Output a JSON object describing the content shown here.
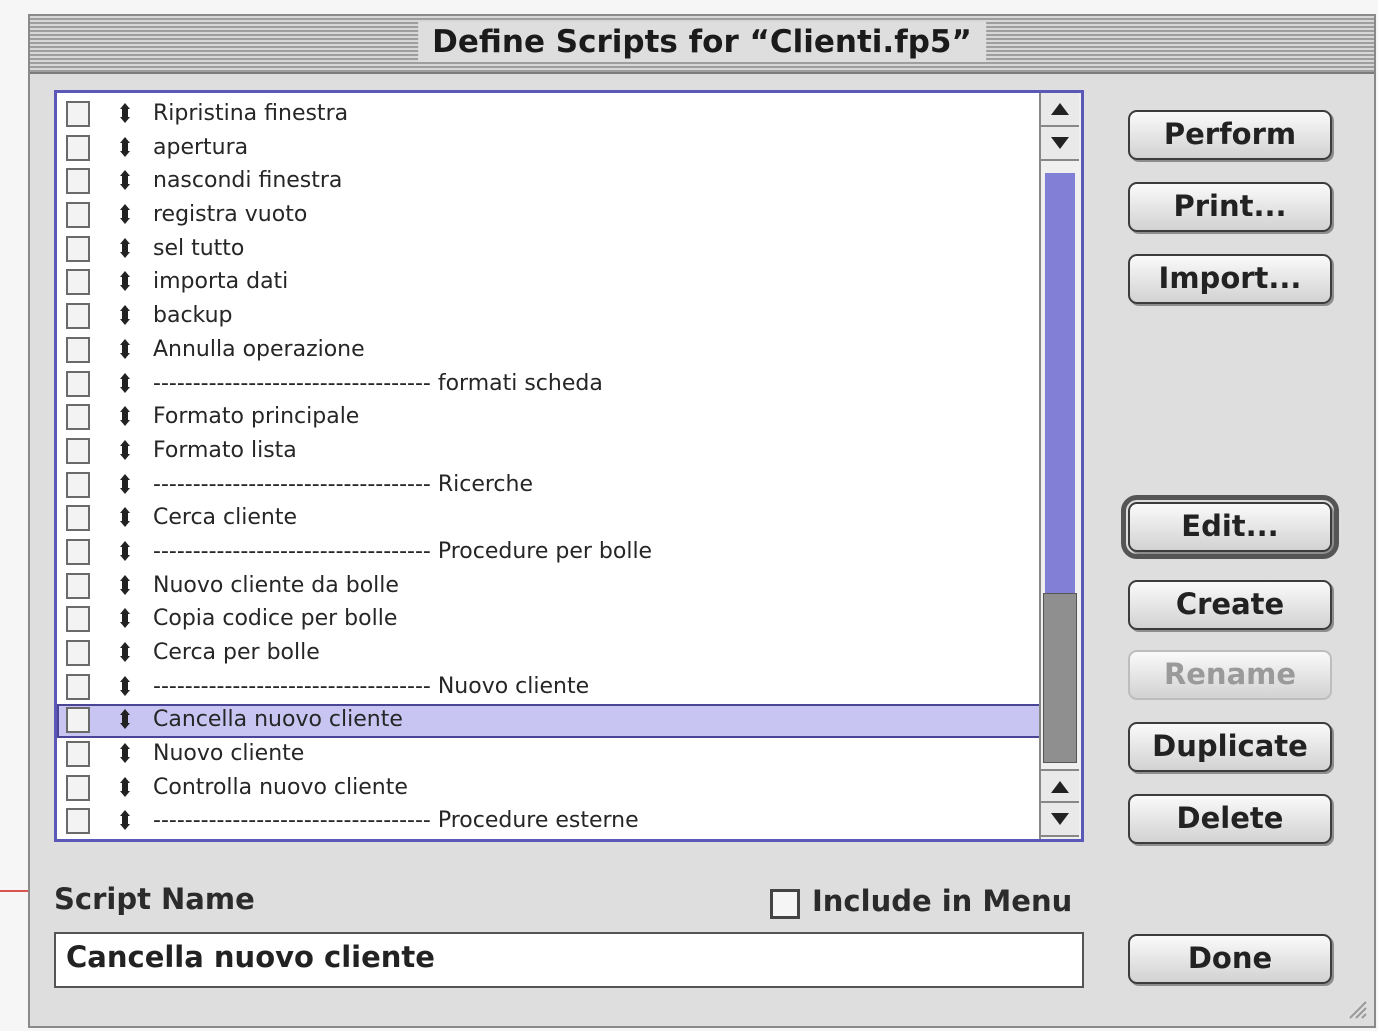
{
  "window": {
    "title": "Define Scripts for “Clienti.fp5”"
  },
  "scripts": [
    {
      "label": "Ripristina finestra",
      "included": false
    },
    {
      "label": "apertura",
      "included": false
    },
    {
      "label": "nascondi finestra",
      "included": false
    },
    {
      "label": "registra vuoto",
      "included": false
    },
    {
      "label": "sel tutto",
      "included": false
    },
    {
      "label": "importa dati",
      "included": false
    },
    {
      "label": "backup",
      "included": false
    },
    {
      "label": "Annulla operazione",
      "included": false
    },
    {
      "label": "----------------------------------- formati scheda",
      "included": false
    },
    {
      "label": "Formato principale",
      "included": false
    },
    {
      "label": "Formato lista",
      "included": false
    },
    {
      "label": "----------------------------------- Ricerche",
      "included": false
    },
    {
      "label": "Cerca cliente",
      "included": false
    },
    {
      "label": "----------------------------------- Procedure per bolle",
      "included": false
    },
    {
      "label": "Nuovo cliente da bolle",
      "included": false
    },
    {
      "label": "Copia codice per bolle",
      "included": false
    },
    {
      "label": "Cerca per bolle",
      "included": false
    },
    {
      "label": "----------------------------------- Nuovo cliente",
      "included": false
    },
    {
      "label": "Cancella nuovo cliente",
      "included": false,
      "selected": true
    },
    {
      "label": "Nuovo cliente",
      "included": false
    },
    {
      "label": "Controlla nuovo cliente",
      "included": false
    },
    {
      "label": "----------------------------------- Procedure esterne",
      "included": false
    }
  ],
  "list_scroll": {
    "thumb_position_fraction": 0.62
  },
  "buttons": {
    "perform": "Perform",
    "print": "Print...",
    "import": "Import...",
    "edit": "Edit...",
    "create": "Create",
    "rename": "Rename",
    "duplicate": "Duplicate",
    "delete": "Delete",
    "done": "Done"
  },
  "form": {
    "script_name_label": "Script Name",
    "script_name_value": "Cancella nuovo cliente",
    "include_in_menu_label": "Include in Menu",
    "include_in_menu_checked": false
  },
  "colors": {
    "selection": "#c9c5f2",
    "accent": "#5b58b8"
  },
  "icons": [
    "move-handle-icon",
    "scroll-up-arrow-icon",
    "scroll-down-arrow-icon",
    "resize-grip-icon"
  ]
}
